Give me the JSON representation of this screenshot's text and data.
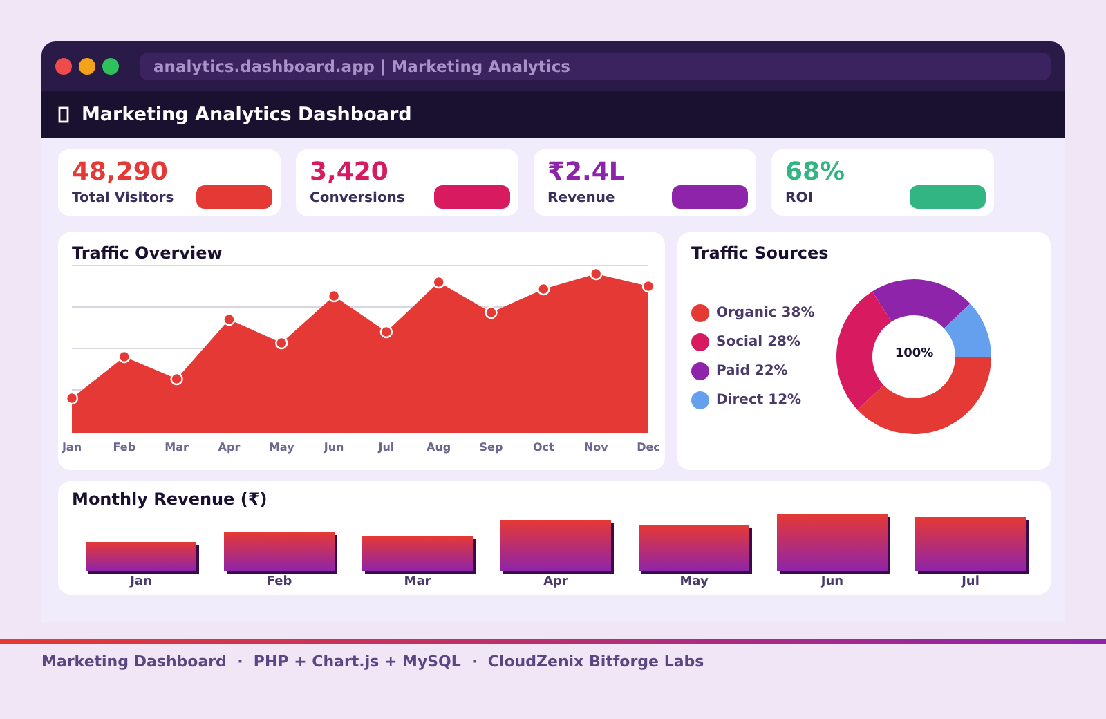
{
  "window": {
    "address": "analytics.dashboard.app | Marketing Analytics"
  },
  "header": {
    "title": "Marketing Analytics Dashboard"
  },
  "kpis": [
    {
      "value": "48,290",
      "label": "Total Visitors",
      "color": "#e53935"
    },
    {
      "value": "3,420",
      "label": "Conversions",
      "color": "#d81b60"
    },
    {
      "value": "₹2.4L",
      "label": "Revenue",
      "color": "#8e24aa"
    },
    {
      "value": "68%",
      "label": "ROI",
      "color": "#33b583"
    }
  ],
  "traffic_overview": {
    "title": "Traffic Overview",
    "x_labels": [
      "Jan",
      "Feb",
      "Mar",
      "Apr",
      "May",
      "Jun",
      "Jul",
      "Aug",
      "Sep",
      "Oct",
      "Nov",
      "Dec"
    ]
  },
  "traffic_sources": {
    "center_label": "100%",
    "chart_data": {
      "type": "donut",
      "title": "Traffic Sources",
      "categories": [
        "Organic 38%",
        "Social 28%",
        "Paid 22%",
        "Direct 12%"
      ],
      "values": [
        38,
        28,
        22,
        12
      ],
      "colors": [
        "#e53935",
        "#d81b60",
        "#8e24aa",
        "#64a0ee"
      ]
    }
  },
  "monthly_revenue": {
    "title": "Monthly Revenue (₹)",
    "x_labels": [
      "Jan",
      "Feb",
      "Mar",
      "Apr",
      "May",
      "Jun",
      "Jul"
    ]
  },
  "footer": {
    "text": "Marketing Dashboard  ·  PHP + Chart.js + MySQL  ·  CloudZenix Bitforge Labs"
  }
}
